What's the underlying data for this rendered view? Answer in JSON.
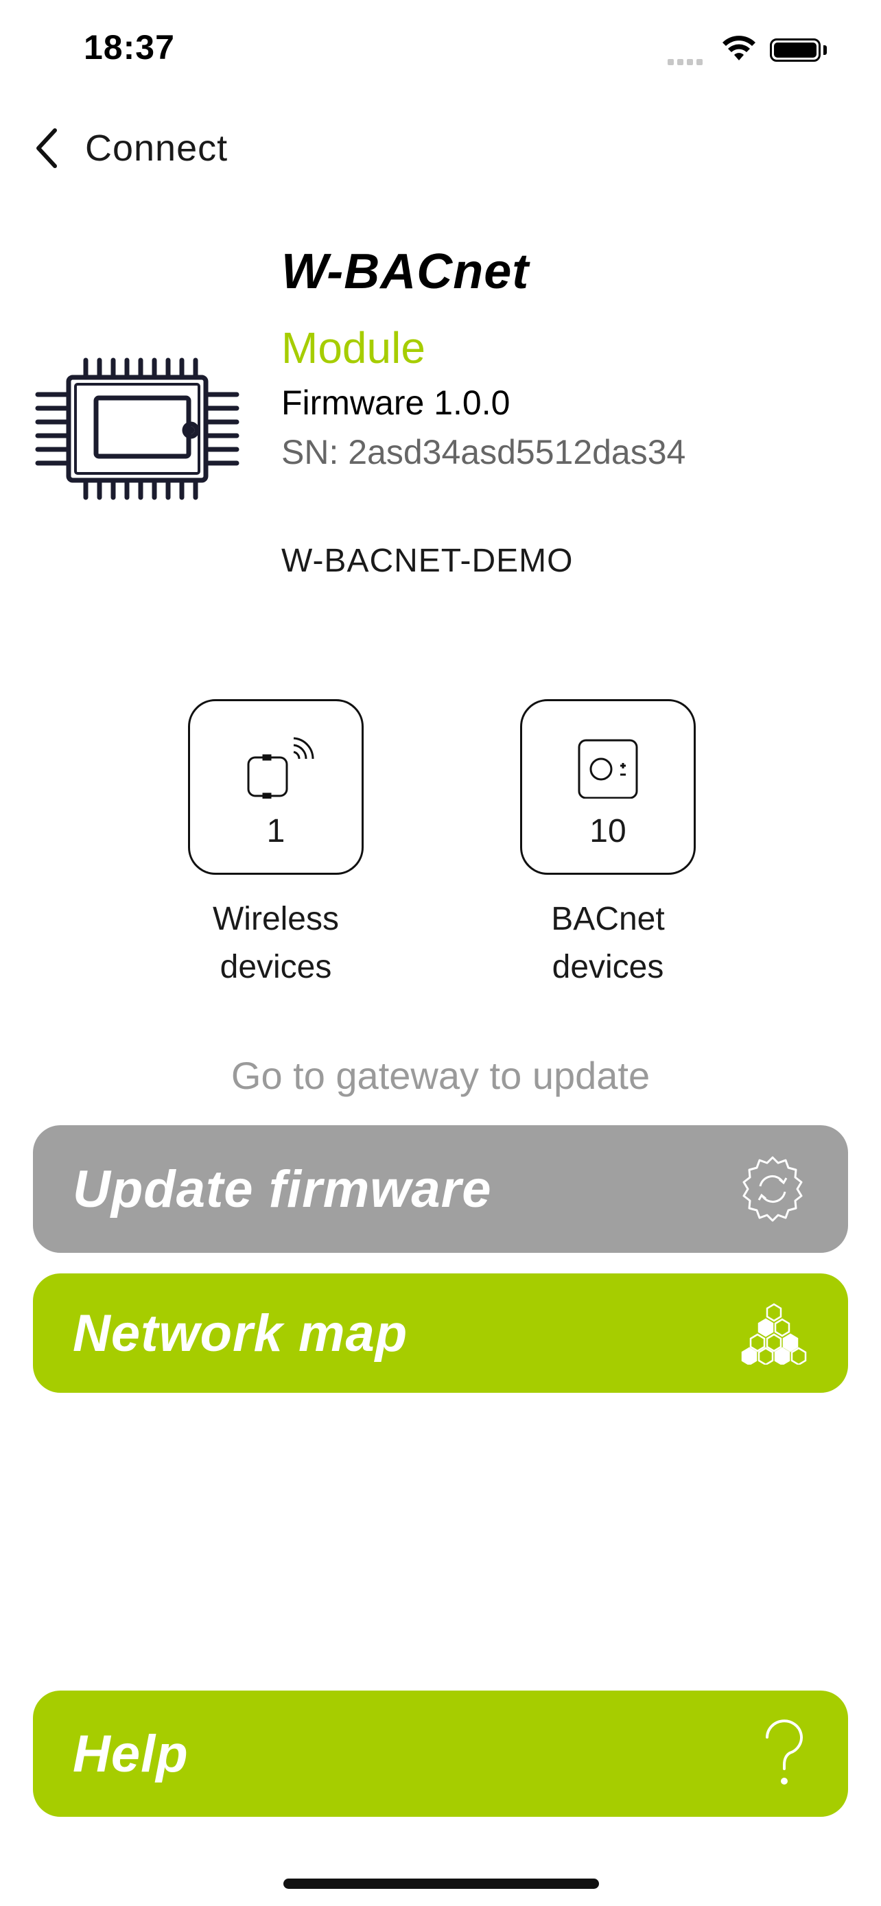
{
  "status": {
    "time": "18:37"
  },
  "nav": {
    "back_label": "Connect"
  },
  "device": {
    "title": "W-BACnet",
    "subtitle": "Module",
    "firmware": "Firmware 1.0.0",
    "serial": "SN: 2asd34asd5512das34",
    "name": "W-BACNET-DEMO"
  },
  "tiles": [
    {
      "icon": "wireless-device-icon",
      "count": "1",
      "label_line1": "Wireless",
      "label_line2": "devices"
    },
    {
      "icon": "bacnet-device-icon",
      "count": "10",
      "label_line1": "BACnet",
      "label_line2": "devices"
    }
  ],
  "hint": "Go to gateway to update",
  "buttons": {
    "update": {
      "label": "Update firmware",
      "icon": "gear-refresh-icon",
      "color": "#a0a0a0"
    },
    "network": {
      "label": "Network map",
      "icon": "hexagon-cluster-icon",
      "color": "#a6cd00"
    },
    "help": {
      "label": "Help",
      "icon": "question-icon",
      "color": "#a6cd00"
    }
  },
  "colors": {
    "accent": "#a6cd00",
    "disabled": "#a0a0a0"
  }
}
